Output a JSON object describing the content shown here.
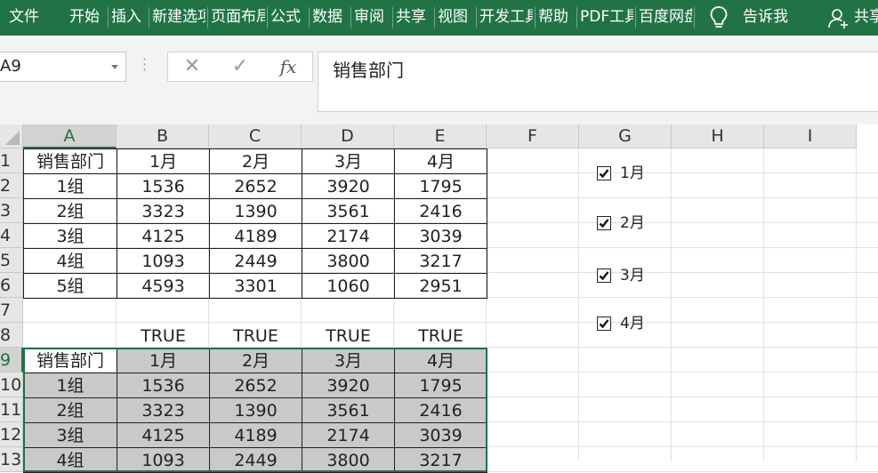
{
  "ribbon": {
    "tabs": [
      "文件",
      "开始",
      "插入",
      "新建选项卡",
      "页面布局",
      "公式",
      "数据",
      "审阅",
      "共享",
      "视图",
      "开发工具",
      "帮助",
      "PDF工具",
      "百度网盘"
    ],
    "tell_me": "告诉我",
    "share": "共享"
  },
  "formula_bar": {
    "name_box": "A9",
    "formula": "销售部门"
  },
  "columns": [
    "A",
    "B",
    "C",
    "D",
    "E",
    "F",
    "G",
    "H",
    "I"
  ],
  "rows": [
    "1",
    "2",
    "3",
    "4",
    "5",
    "6",
    "7",
    "8",
    "9",
    "10",
    "11",
    "12",
    "13"
  ],
  "table1": {
    "header": [
      "销售部门",
      "1月",
      "2月",
      "3月",
      "4月"
    ],
    "rows": [
      [
        "1组",
        "1536",
        "2652",
        "3920",
        "1795"
      ],
      [
        "2组",
        "3323",
        "1390",
        "3561",
        "2416"
      ],
      [
        "3组",
        "4125",
        "4189",
        "2174",
        "3039"
      ],
      [
        "4组",
        "1093",
        "2449",
        "3800",
        "3217"
      ],
      [
        "5组",
        "4593",
        "3301",
        "1060",
        "2951"
      ]
    ]
  },
  "row8": [
    "TRUE",
    "TRUE",
    "TRUE",
    "TRUE"
  ],
  "table2": {
    "header": [
      "销售部门",
      "1月",
      "2月",
      "3月",
      "4月"
    ],
    "rows": [
      [
        "1组",
        "1536",
        "2652",
        "3920",
        "1795"
      ],
      [
        "2组",
        "3323",
        "1390",
        "3561",
        "2416"
      ],
      [
        "3组",
        "4125",
        "4189",
        "2174",
        "3039"
      ],
      [
        "4组",
        "1093",
        "2449",
        "3800",
        "3217"
      ]
    ]
  },
  "checkboxes": [
    {
      "label": "1月",
      "checked": true
    },
    {
      "label": "2月",
      "checked": true
    },
    {
      "label": "3月",
      "checked": true
    },
    {
      "label": "4月",
      "checked": true
    }
  ],
  "colors": {
    "accent": "#217346",
    "header_bg": "#e6e6e6",
    "shade": "#c9c9c9"
  }
}
